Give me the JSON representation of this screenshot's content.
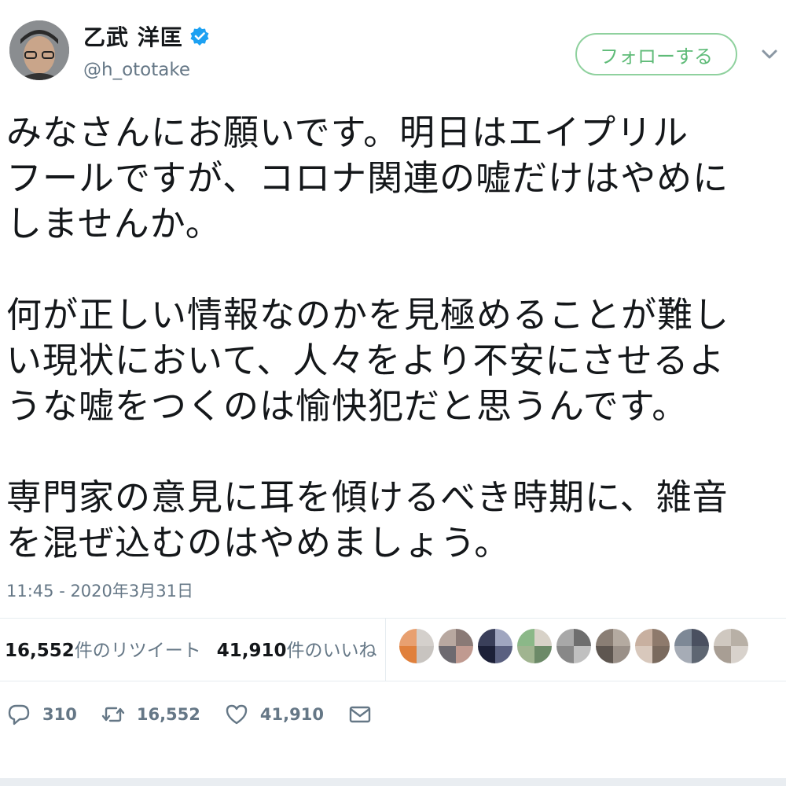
{
  "author": {
    "name": "乙武 洋匡",
    "handle": "@h_ototake",
    "verified": true
  },
  "follow_button": {
    "label": "フォローする"
  },
  "tweet": {
    "text": "みなさんにお願いです。明日はエイプリル\nフールですが、コロナ関連の嘘だけはやめに\nしませんか。\n\n何が正しい情報なのかを見極めることが難し\nい現状において、人々をより不安にさせるよ\nうな嘘をつくのは愉快犯だと思うんです。\n\n専門家の意見に耳を傾けるべき時期に、雑音\nを混ぜ込むのはやめましょう。",
    "timestamp": "11:45 - 2020年3月31日"
  },
  "stats": {
    "retweets_count": "16,552",
    "retweets_label": "件のリツイート",
    "likes_count": "41,910",
    "likes_label": "件のいいね"
  },
  "actions": {
    "reply": "310",
    "retweet": "16,552",
    "like": "41,910"
  },
  "colors": {
    "text": "#14171a",
    "secondary": "#657786",
    "verified": "#1da1f2",
    "follow": "#5fbb78"
  },
  "icons": [
    "verified-badge-icon",
    "chevron-down-icon",
    "reply-icon",
    "retweet-icon",
    "like-icon",
    "message-icon"
  ]
}
